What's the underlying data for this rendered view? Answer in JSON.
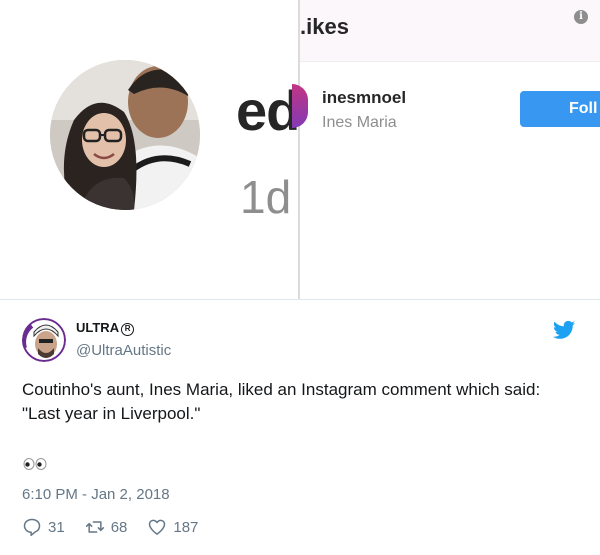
{
  "instagram": {
    "big_text_1": "ed",
    "big_text_2": "1d",
    "likes_title": ".ikes",
    "info_icon_glyph": "i",
    "liker": {
      "username": "inesmnoel",
      "full_name": "Ines Maria"
    },
    "follow_label": "Foll"
  },
  "tweet": {
    "display_name": "ULTRA",
    "registered_glyph": "R",
    "handle": "@UltraAutistic",
    "text": "Coutinho's aunt, Ines Maria, liked an Instagram comment which said: \"Last year in Liverpool.\"",
    "timestamp": "6:10 PM - Jan 2, 2018",
    "replies": "31",
    "retweets": "68",
    "likes": "187",
    "colors": {
      "twitter_blue": "#1da1f2",
      "secondary_text": "#657786"
    }
  }
}
